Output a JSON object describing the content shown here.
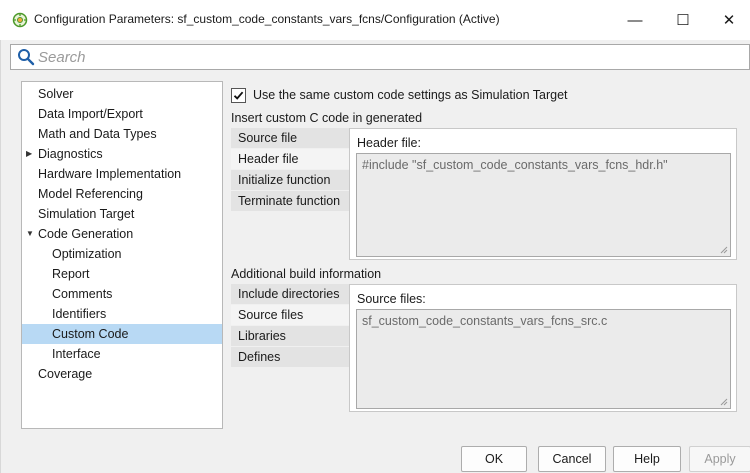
{
  "window": {
    "title": "Configuration Parameters: sf_custom_code_constants_vars_fcns/Configuration (Active)",
    "minimize": "—",
    "maximize": "☐",
    "close": "✕"
  },
  "search": {
    "placeholder": "Search"
  },
  "tree": {
    "items": [
      {
        "label": "Solver"
      },
      {
        "label": "Data Import/Export"
      },
      {
        "label": "Math and Data Types"
      },
      {
        "label": "Diagnostics",
        "arrow": "▶"
      },
      {
        "label": "Hardware Implementation"
      },
      {
        "label": "Model Referencing"
      },
      {
        "label": "Simulation Target"
      },
      {
        "label": "Code Generation",
        "arrow": "▼"
      },
      {
        "label": "Optimization"
      },
      {
        "label": "Report"
      },
      {
        "label": "Comments"
      },
      {
        "label": "Identifiers"
      },
      {
        "label": "Custom Code"
      },
      {
        "label": "Interface"
      },
      {
        "label": "Coverage"
      }
    ],
    "selected": "Custom Code"
  },
  "custom_code": {
    "checkbox_label": "Use the same custom code settings as Simulation Target",
    "checkbox_checked": true,
    "insert_section_label": "Insert custom C code in generated",
    "insert_tabs": [
      "Source file",
      "Header file",
      "Initialize function",
      "Terminate function"
    ],
    "insert_active_tab": "Header file",
    "header_field_label": "Header file:",
    "header_field_value": "#include \"sf_custom_code_constants_vars_fcns_hdr.h\"",
    "build_section_label": "Additional build information",
    "build_tabs": [
      "Include directories",
      "Source files",
      "Libraries",
      "Defines"
    ],
    "build_active_tab": "Source files",
    "source_field_label": "Source files:",
    "source_field_value": "sf_custom_code_constants_vars_fcns_src.c"
  },
  "buttons": {
    "ok": "OK",
    "cancel": "Cancel",
    "help": "Help",
    "apply": "Apply"
  },
  "colors": {
    "selection": "#b8d9f4",
    "panel_bg": "#f0f0f0",
    "field_bg": "#ebebeb"
  }
}
